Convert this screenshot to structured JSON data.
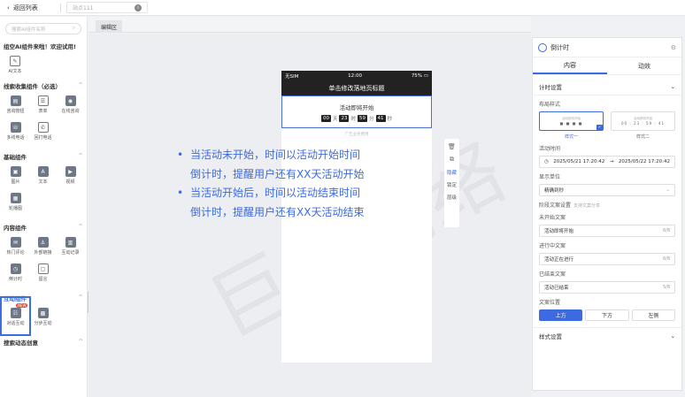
{
  "topbar": {
    "back_label": "返回列表",
    "page_name": "站点111"
  },
  "sidebar": {
    "search_placeholder": "搜索AI组件名称",
    "promo": "组空AI组件来啦！欢迎试用!",
    "ai_item": "AI文本",
    "sections": [
      {
        "title": "线索收集组件（必选）",
        "items": [
          "咨询按钮",
          "表单",
          "在线咨询",
          "多线电话",
          "回打电话"
        ]
      },
      {
        "title": "基础组件",
        "items": [
          "图片",
          "文本",
          "视频",
          "轮播图"
        ]
      },
      {
        "title": "内容组件",
        "items": [
          "热门评论",
          "外部链接",
          "互动记录",
          "倒计时",
          "留言"
        ]
      },
      {
        "title": "互动组件",
        "items": [
          "对话互动",
          "分步互动"
        ],
        "badge": "NEW"
      },
      {
        "title": "搜索动态创意",
        "items": []
      }
    ]
  },
  "canvas": {
    "tab": "编辑区",
    "phone": {
      "carrier": "无SIM",
      "time": "12:00",
      "battery": "75%",
      "title": "单击修改落地页标题",
      "countdown_title": "活动即将开始",
      "digits": [
        "00",
        "23",
        "59",
        "41"
      ],
      "units": [
        "天",
        "时",
        "分",
        "秒"
      ],
      "support": "广告业务费用"
    },
    "bullets": [
      [
        "当活动未开始，时间以活动开始时间",
        "倒计时，提醒用户还有XX天活动开始"
      ],
      [
        "当活动开始后，时间以活动结束时间",
        "倒计时，提醒用户还有XX天活动结束"
      ]
    ],
    "watermark": "巨量网络",
    "toolstrip": [
      "删除",
      "复制",
      "隐藏",
      "锁定",
      "层级",
      "置顶"
    ]
  },
  "panel": {
    "title": "倒计时",
    "tabs": [
      "内容",
      "动效"
    ],
    "settings": "计时设置",
    "layout_label": "布局样式",
    "style_one": "样式一",
    "style_two": "样式二",
    "style_preview_top": "活动即将开始",
    "style_preview_digits": "00 : 23 : 59 : 41",
    "time_label": "活动时间",
    "time_start": "2025/05/21 17:20:42",
    "time_sep": "→",
    "time_end": "2025/05/22 17:20:42",
    "unit_label": "显示单位",
    "unit_value": "精确到秒",
    "stage_label": "阶段文案设置",
    "stage_hint": "支持文案分享",
    "not_started_label": "未开始文案",
    "not_started_value": "活动即将开始",
    "in_progress_label": "进行中文案",
    "in_progress_value": "活动正在进行",
    "ended_label": "已结束文案",
    "ended_value": "活动已结束",
    "counts": [
      "6/8",
      "6/8",
      "5/8"
    ],
    "position_label": "文案位置",
    "positions": [
      "上方",
      "下方",
      "左侧"
    ],
    "style_settings": "样式设置"
  },
  "colors": {
    "accent": "#3c6ae0",
    "highlight": "#3b6fe0",
    "dark": "#222222"
  }
}
